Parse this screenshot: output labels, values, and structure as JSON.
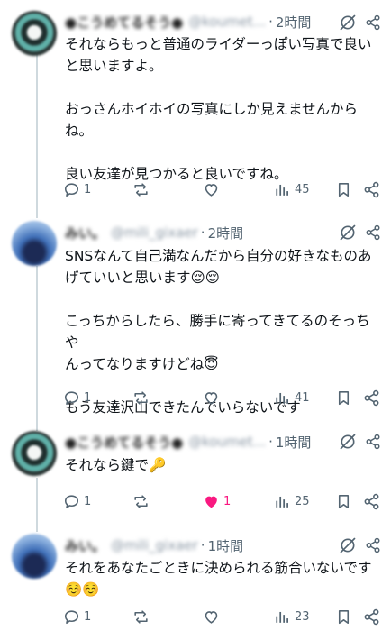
{
  "tweets": [
    {
      "author": "●こうめてるそう●",
      "handle": "@koumet...",
      "time": "2時間",
      "lines": [
        "それならもっと普通のライダーっぽい写真で良い",
        "と思いますよ。",
        "",
        "おっさんホイホイの写真にしか見えませんから",
        "ね。",
        "",
        "良い友達が見つかると良いですね。"
      ],
      "replies": "1",
      "reposts": "",
      "likes": "",
      "views": "45",
      "liked": false
    },
    {
      "author": "みい。",
      "handle": "@mili_gixaer",
      "time": "2時間",
      "lines": [
        "SNSなんて自己満なんだから自分の好きなものあ",
        "げていいと思います😌😌",
        "",
        "こっちからしたら、勝手に寄ってきてるのそっちや",
        "んってなりますけどね😇",
        "",
        "もう友達沢山できたんでいらないです"
      ],
      "replies": "1",
      "reposts": "",
      "likes": "",
      "views": "41",
      "liked": false
    },
    {
      "author": "●こうめてるそう●",
      "handle": "@koumet...",
      "time": "1時間",
      "lines": [
        "それなら鍵で🔑"
      ],
      "replies": "1",
      "reposts": "",
      "likes": "1",
      "views": "25",
      "liked": true
    },
    {
      "author": "みい。",
      "handle": "@mili_gixaer",
      "time": "1時間",
      "lines": [
        "それをあなたごときに決められる筋合いないです",
        "☺️☺️"
      ],
      "replies": "1",
      "reposts": "",
      "likes": "",
      "views": "23",
      "liked": false
    }
  ],
  "separator": "·",
  "colors": {
    "text": "#0f1419",
    "muted": "#536471",
    "like": "#f91880",
    "thread_line": "#cfd9de"
  },
  "icons": {
    "more": "grok-icon",
    "share": "share-icon",
    "reply": "reply-icon",
    "repost": "repost-icon",
    "like": "heart-icon",
    "views": "views-icon",
    "bookmark": "bookmark-icon"
  }
}
